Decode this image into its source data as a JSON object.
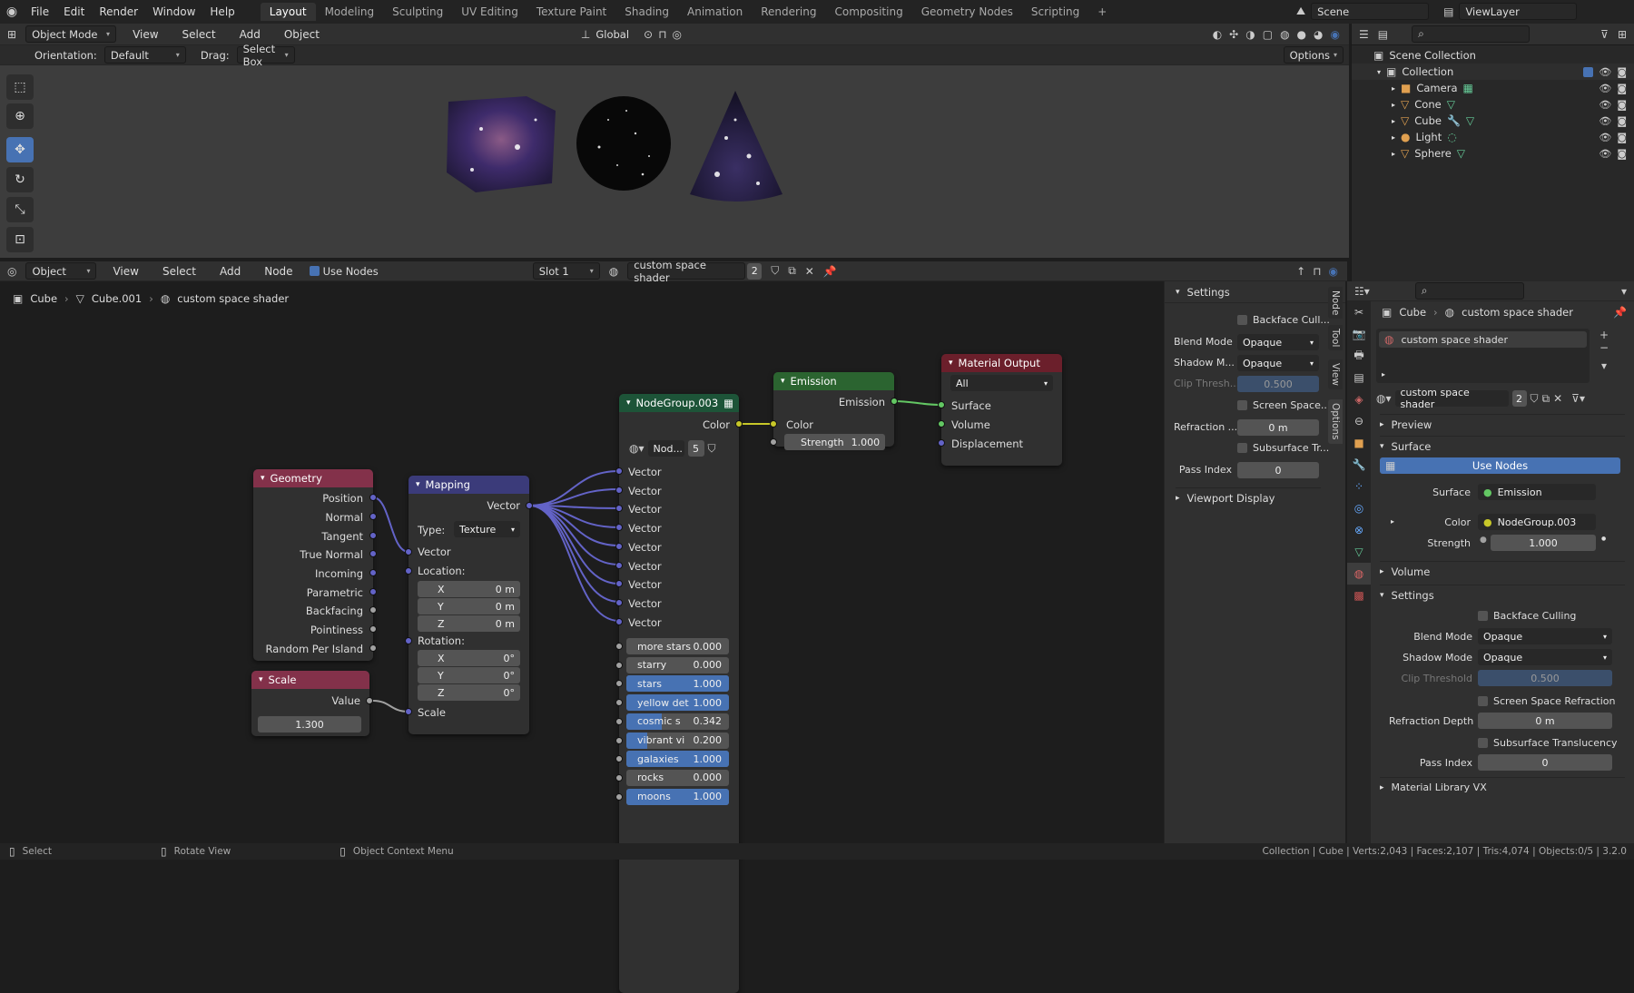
{
  "menubar": {
    "items": [
      "File",
      "Edit",
      "Render",
      "Window",
      "Help"
    ],
    "workspaces": [
      "Layout",
      "Modeling",
      "Sculpting",
      "UV Editing",
      "Texture Paint",
      "Shading",
      "Animation",
      "Rendering",
      "Compositing",
      "Geometry Nodes",
      "Scripting"
    ],
    "active_workspace": "Layout",
    "add_tab": "+",
    "scene": "Scene",
    "view_layer": "ViewLayer"
  },
  "viewport_header": {
    "mode": "Object Mode",
    "menus": [
      "View",
      "Select",
      "Add",
      "Object"
    ],
    "transform": "Global",
    "orientation_label": "Orientation:",
    "orientation_value": "Default",
    "drag_label": "Drag:",
    "drag_value": "Select Box",
    "options": "Options"
  },
  "node_header": {
    "editor_type": "Object",
    "menus": [
      "View",
      "Select",
      "Add",
      "Node"
    ],
    "use_nodes": "Use Nodes",
    "slot": "Slot 1",
    "material": "custom space shader",
    "users": "2"
  },
  "breadcrumb": {
    "object": "Cube",
    "mesh": "Cube.001",
    "material": "custom space shader"
  },
  "nodes": {
    "geometry": {
      "title": "Geometry",
      "outputs": [
        "Position",
        "Normal",
        "Tangent",
        "True Normal",
        "Incoming",
        "Parametric",
        "Backfacing",
        "Pointiness",
        "Random Per Island"
      ]
    },
    "scale": {
      "title": "Scale",
      "output": "Value",
      "value": "1.300"
    },
    "mapping": {
      "title": "Mapping",
      "output": "Vector",
      "type_label": "Type:",
      "type_value": "Texture",
      "input_vector": "Vector",
      "location": "Location:",
      "rotation": "Rotation:",
      "loc": [
        {
          "axis": "X",
          "val": "0 m"
        },
        {
          "axis": "Y",
          "val": "0 m"
        },
        {
          "axis": "Z",
          "val": "0 m"
        }
      ],
      "rot": [
        {
          "axis": "X",
          "val": "0°"
        },
        {
          "axis": "Y",
          "val": "0°"
        },
        {
          "axis": "Z",
          "val": "0°"
        }
      ],
      "scale": "Scale"
    },
    "group": {
      "title": "NodeGroup.003",
      "output": "Color",
      "subname": "Nod...",
      "subcount": "5",
      "vectors": [
        "Vector",
        "Vector",
        "Vector",
        "Vector",
        "Vector",
        "Vector",
        "Vector",
        "Vector",
        "Vector"
      ],
      "params": [
        {
          "name": "more stars",
          "value": "0.000",
          "fill": 0
        },
        {
          "name": "starry",
          "value": "0.000",
          "fill": 0
        },
        {
          "name": "stars",
          "value": "1.000",
          "fill": 1
        },
        {
          "name": "yellow det",
          "value": "1.000",
          "fill": 1
        },
        {
          "name": "cosmic s",
          "value": "0.342",
          "fill": 0.342
        },
        {
          "name": "vibrant vi",
          "value": "0.200",
          "fill": 0.2
        },
        {
          "name": "galaxies",
          "value": "1.000",
          "fill": 1
        },
        {
          "name": "rocks",
          "value": "0.000",
          "fill": 0
        },
        {
          "name": "moons",
          "value": "1.000",
          "fill": 1
        }
      ]
    },
    "emission": {
      "title": "Emission",
      "output": "Emission",
      "color": "Color",
      "strength_label": "Strength",
      "strength": "1.000"
    },
    "output": {
      "title": "Material Output",
      "target": "All",
      "surface": "Surface",
      "volume": "Volume",
      "displacement": "Displacement"
    }
  },
  "side_panel": {
    "section": "Settings",
    "backface": "Backface Cull...",
    "blend_label": "Blend Mode",
    "blend": "Opaque",
    "shadow_label": "Shadow M...",
    "shadow": "Opaque",
    "clip_label": "Clip Thresh...",
    "clip": "0.500",
    "ssr": "Screen Space...",
    "refr_label": "Refraction ...",
    "refr": "0 m",
    "sst": "Subsurface Tr...",
    "pass_label": "Pass Index",
    "pass": "0",
    "viewport_display": "Viewport Display",
    "tabs": [
      "Node",
      "Tool",
      "View",
      "Options"
    ]
  },
  "outliner": {
    "root": "Scene Collection",
    "collection": "Collection",
    "items": [
      "Camera",
      "Cone",
      "Cube",
      "Light",
      "Sphere"
    ]
  },
  "properties": {
    "crumb_object": "Cube",
    "crumb_material": "custom space shader",
    "slot_name": "custom space shader",
    "material": "custom space shader",
    "users": "2",
    "preview": "Preview",
    "surface_section": "Surface",
    "use_nodes": "Use Nodes",
    "surface_label": "Surface",
    "surface_value": "Emission",
    "color_label": "Color",
    "color_value": "NodeGroup.003",
    "strength_label": "Strength",
    "strength_value": "1.000",
    "volume": "Volume",
    "settings": "Settings",
    "backface": "Backface Culling",
    "blend_label": "Blend Mode",
    "blend": "Opaque",
    "shadow_label": "Shadow Mode",
    "shadow": "Opaque",
    "clip_label": "Clip Threshold",
    "clip": "0.500",
    "ssr": "Screen Space Refraction",
    "refr_label": "Refraction Depth",
    "refr": "0 m",
    "sst": "Subsurface Translucency",
    "pass_label": "Pass Index",
    "pass": "0",
    "more": "Material Library VX"
  },
  "statusbar": {
    "select": "Select",
    "rotate": "Rotate View",
    "context": "Object Context Menu",
    "stats": "Collection | Cube | Verts:2,043 | Faces:2,107 | Tris:4,074 | Objects:0/5 | 3.2.0"
  },
  "colors": {
    "accent": "#4772b3",
    "geometry_header": "#83314a",
    "mapping_header": "#3b3b7a",
    "group_header": "#1d5438",
    "emission_header": "#2b6430",
    "output_header": "#6b1f2b"
  }
}
